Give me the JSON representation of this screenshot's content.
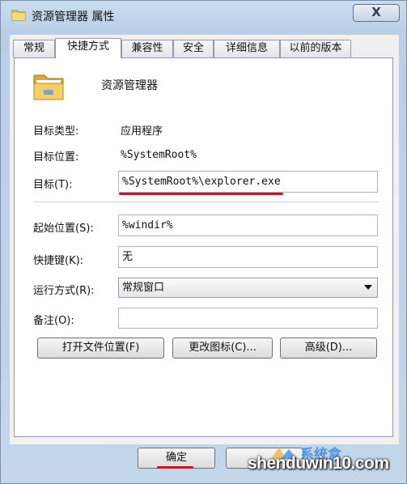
{
  "window": {
    "title": "资源管理器 属性",
    "close_label": "X"
  },
  "tabs": [
    {
      "label": "常规",
      "active": false
    },
    {
      "label": "快捷方式",
      "active": true
    },
    {
      "label": "兼容性",
      "active": false
    },
    {
      "label": "安全",
      "active": false
    },
    {
      "label": "详细信息",
      "active": false
    },
    {
      "label": "以前的版本",
      "active": false
    }
  ],
  "shortcut": {
    "app_name": "资源管理器",
    "target_type_label": "目标类型:",
    "target_type_value": "应用程序",
    "target_location_label": "目标位置:",
    "target_location_value": "%SystemRoot%",
    "target_label": "目标(T):",
    "target_value": "%SystemRoot%\\explorer.exe",
    "start_in_label": "起始位置(S):",
    "start_in_value": "%windir%",
    "hotkey_label": "快捷键(K):",
    "hotkey_value": "无",
    "run_label": "运行方式(R):",
    "run_value": "常规窗口",
    "comment_label": "备注(O):",
    "comment_value": ""
  },
  "buttons": {
    "open_location": "打开文件位置(F)",
    "change_icon": "更改图标(C)...",
    "advanced": "高级(D)...",
    "ok": "确定"
  },
  "watermark": {
    "text": "shenduwin10.com",
    "logo_text": "系统盒"
  },
  "colors": {
    "highlight": "#d0121b",
    "frame": "#c3d6ea"
  },
  "icons": [
    "folder-icon",
    "explorer-folder-icon",
    "dropdown-arrow-icon",
    "watermark-logo-icon"
  ]
}
